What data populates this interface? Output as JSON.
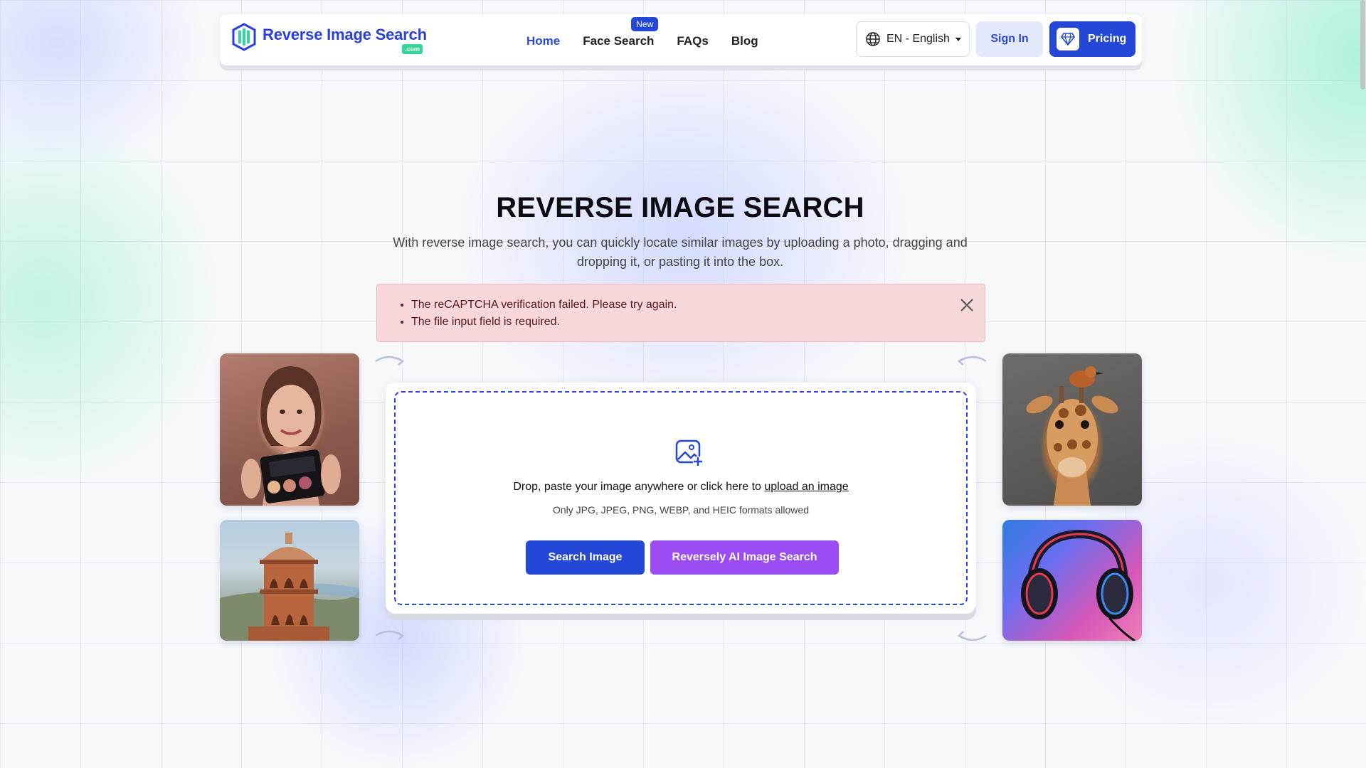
{
  "header": {
    "logo_text": "Reverse Image Search",
    "logo_suffix": ".com",
    "nav": [
      {
        "label": "Home",
        "active": true
      },
      {
        "label": "Face Search",
        "badge": "New"
      },
      {
        "label": "FAQs"
      },
      {
        "label": "Blog"
      }
    ],
    "language": "EN - English",
    "sign_in": "Sign In",
    "pricing": "Pricing"
  },
  "hero": {
    "title": "REVERSE IMAGE SEARCH",
    "subtitle": "With reverse image search, you can quickly locate similar images by uploading a photo, dragging and dropping it, or pasting it into the box."
  },
  "alert": {
    "errors": [
      "The reCAPTCHA verification failed. Please try again.",
      "The file input field is required."
    ]
  },
  "upload": {
    "prompt_prefix": "Drop, paste your image anywhere or click here to ",
    "prompt_link": "upload an image",
    "formats": "Only JPG, JPEG, PNG, WEBP, and HEIC formats allowed",
    "search_button": "Search Image",
    "ai_button": "Reversely AI Image Search"
  },
  "sample_images": [
    "woman-with-makeup-palette",
    "palace-pavilion",
    "giraffe-with-bird",
    "headphones"
  ],
  "icons": [
    "logo-icon",
    "globe-icon",
    "caret-down-icon",
    "diamond-icon",
    "close-icon",
    "image-plus-icon",
    "curved-arrow-icon"
  ],
  "colors": {
    "primary": "#2447d8",
    "ai_button": "#9b4cf2",
    "alert_bg": "#f8d7da",
    "alert_text": "#58151c",
    "logo_green": "#35d69a"
  }
}
